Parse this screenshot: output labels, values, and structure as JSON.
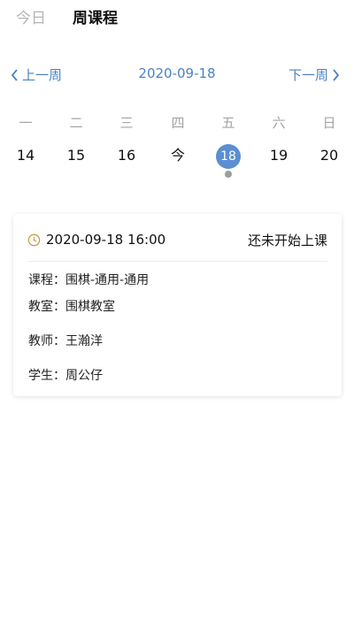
{
  "header": {
    "tab_today": "今日",
    "tab_week": "周课程"
  },
  "week_nav": {
    "prev_label": "上一周",
    "current_date": "2020-09-18",
    "next_label": "下一周"
  },
  "weekdays": [
    "一",
    "二",
    "三",
    "四",
    "五",
    "六",
    "日"
  ],
  "dates": [
    "14",
    "15",
    "16",
    "今",
    "18",
    "19",
    "20"
  ],
  "selected_index": 4,
  "card": {
    "time": "2020-09-18 16:00",
    "status": "还未开始上课",
    "course_label": "课程：",
    "course_value": "围棋-通用-通用",
    "room_label": "教室：",
    "room_value": "围棋教室",
    "teacher_label": "教师：",
    "teacher_value": "王瀚洋",
    "student_label": "学生：",
    "student_value": "周公仔"
  },
  "colors": {
    "accent": "#4a83c4",
    "selected_bg": "#5b8ed2",
    "clock_icon": "#c9a04a",
    "muted": "#a4a4a4"
  },
  "icons": {
    "prev": "chevron-left-icon",
    "next": "chevron-right-icon",
    "time": "clock-icon"
  }
}
